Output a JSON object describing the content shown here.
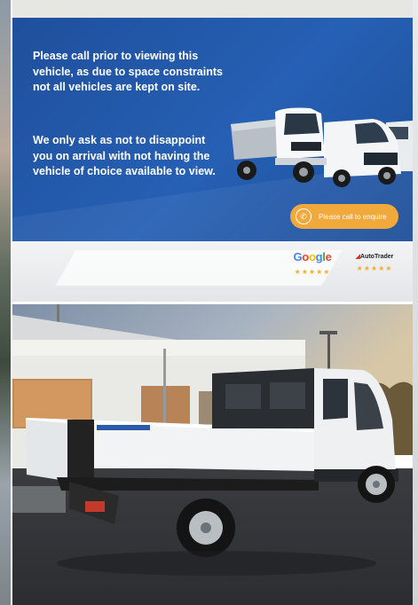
{
  "banner": {
    "notice_1": "Please call prior to viewing this vehicle, as due to space constraints not all vehicles are kept on site.",
    "notice_2": "We only ask as not to disappoint you on arrival with not having the vehicle of choice available to view.",
    "cta_label": "Please call to enquire",
    "cta_icon": "phone-icon",
    "review_sites": [
      {
        "name": "Google",
        "stars": "★★★★★"
      },
      {
        "name": "AutoTrader",
        "stars": "★★★★★"
      }
    ],
    "colors": {
      "blue": "#2660b4",
      "orange": "#f0a93a",
      "star": "#f4b02c"
    }
  }
}
